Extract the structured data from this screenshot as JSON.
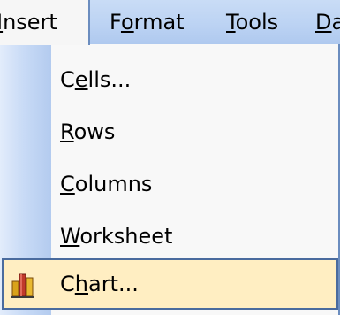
{
  "menubar": {
    "insert": {
      "pre": "",
      "ul": "I",
      "post": "nsert"
    },
    "format": {
      "pre": "F",
      "ul": "o",
      "post": "rmat"
    },
    "tools": {
      "pre": "",
      "ul": "T",
      "post": "ools"
    },
    "data": {
      "pre": "",
      "ul": "D",
      "post": "a"
    }
  },
  "dropdown": {
    "cells": {
      "pre": "C",
      "ul": "e",
      "post": "lls..."
    },
    "rows": {
      "pre": "",
      "ul": "R",
      "post": "ows"
    },
    "columns": {
      "pre": "",
      "ul": "C",
      "post": "olumns"
    },
    "worksheet": {
      "pre": "",
      "ul": "W",
      "post": "orksheet"
    },
    "chart": {
      "pre": "C",
      "ul": "h",
      "post": "art...",
      "icon": "chart-icon"
    }
  },
  "colors": {
    "menubar_bg": "#bcd3f3",
    "highlight_bg": "#ffeec2",
    "highlight_border": "#4a6b9e",
    "icon_column": "#c9dbf6"
  }
}
